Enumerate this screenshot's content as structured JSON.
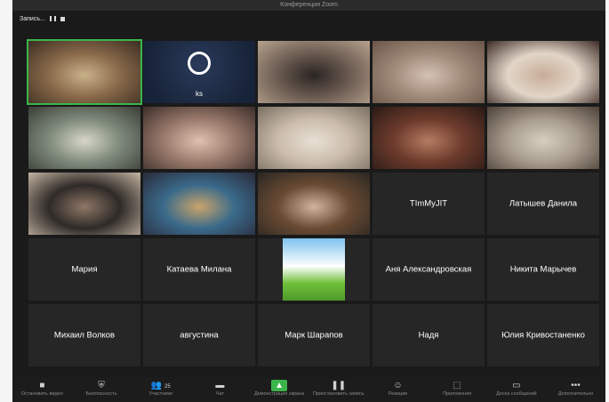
{
  "window": {
    "title": "Конференция Zoom"
  },
  "recording": {
    "label": "Запись...",
    "pause_icon": "pause-icon",
    "stop_icon": "stop-icon"
  },
  "participants": [
    {
      "name": "",
      "type": "video",
      "colors": [
        "#8a6a4a",
        "#c9b28a",
        "#3a2d22"
      ]
    },
    {
      "name": "ks",
      "type": "logo",
      "colors": [
        "#2a3a5a",
        "#172338",
        "#ffffff"
      ]
    },
    {
      "name": "",
      "type": "video",
      "colors": [
        "#6a5a50",
        "#2a2523",
        "#b7a38f"
      ]
    },
    {
      "name": "",
      "type": "video",
      "colors": [
        "#a08a7a",
        "#d5c2b5",
        "#6a5548"
      ]
    },
    {
      "name": "",
      "type": "video",
      "colors": [
        "#e2d6c8",
        "#c8ad98",
        "#3c2b25"
      ]
    },
    {
      "name": "",
      "type": "video",
      "colors": [
        "#7f8b7c",
        "#d7d6c9",
        "#3a3d35"
      ]
    },
    {
      "name": "",
      "type": "video",
      "colors": [
        "#9a7a6c",
        "#e0c1b0",
        "#3b2d29"
      ]
    },
    {
      "name": "",
      "type": "video",
      "colors": [
        "#cbbcab",
        "#e8e0d4",
        "#7a6f62"
      ]
    },
    {
      "name": "",
      "type": "video",
      "colors": [
        "#6d3b2c",
        "#b47b61",
        "#2a1a16"
      ]
    },
    {
      "name": "",
      "type": "video",
      "colors": [
        "#a89d8e",
        "#d8cfc1",
        "#4c4037"
      ]
    },
    {
      "name": "",
      "type": "video",
      "colors": [
        "#2f2a28",
        "#8e7766",
        "#c5b6a3"
      ]
    },
    {
      "name": "",
      "type": "video",
      "colors": [
        "#3a6a8a",
        "#caa46a",
        "#2a2a3a"
      ]
    },
    {
      "name": "",
      "type": "video",
      "colors": [
        "#6a4b33",
        "#d2b39b",
        "#2a2622"
      ]
    },
    {
      "name": "TImMyJIT",
      "type": "name"
    },
    {
      "name": "Латышев Данила",
      "type": "name"
    },
    {
      "name": "Мария",
      "type": "name"
    },
    {
      "name": "Катаева Милана",
      "type": "name"
    },
    {
      "name": "",
      "type": "image",
      "colors": [
        "#7ec3ee",
        "#ffffff",
        "#6fbf3a"
      ]
    },
    {
      "name": "Аня Александровская",
      "type": "name"
    },
    {
      "name": "Никита Марычев",
      "type": "name"
    },
    {
      "name": "Михаил Волков",
      "type": "name"
    },
    {
      "name": "августина",
      "type": "name"
    },
    {
      "name": "Марк Шарапов",
      "type": "name"
    },
    {
      "name": "Надя",
      "type": "name"
    },
    {
      "name": "Юлия Кривостаненко",
      "type": "name"
    }
  ],
  "toolbar": {
    "items": [
      {
        "label": "Остановить видео",
        "icon": "video-camera-icon"
      },
      {
        "label": "Безопасность",
        "icon": "shield-icon"
      },
      {
        "label": "Участники",
        "icon": "participants-icon"
      },
      {
        "label": "Чат",
        "icon": "chat-icon"
      },
      {
        "label": "Демонстрация экрана",
        "icon": "share-screen-icon"
      },
      {
        "label": "Приостановить запись",
        "icon": "pause-record-icon"
      },
      {
        "label": "Реакции",
        "icon": "reactions-icon"
      },
      {
        "label": "Приложения",
        "icon": "apps-icon"
      },
      {
        "label": "Доска сообщений",
        "icon": "whiteboard-icon"
      },
      {
        "label": "Дополнительно",
        "icon": "more-icon"
      }
    ],
    "participants_count": "25"
  }
}
